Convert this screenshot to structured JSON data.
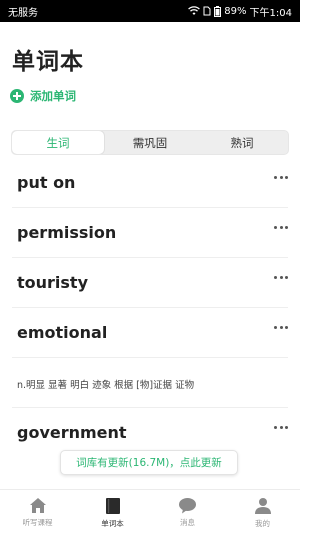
{
  "status_bar": {
    "carrier": "无服务",
    "battery": "89%",
    "time": "下午1:04"
  },
  "page": {
    "title": "单词本",
    "add_word_label": "添加单词"
  },
  "tabs": [
    {
      "label": "生词",
      "active": true
    },
    {
      "label": "需巩固",
      "active": false
    },
    {
      "label": "熟词",
      "active": false
    }
  ],
  "words": [
    {
      "text": "put on"
    },
    {
      "text": "permission"
    },
    {
      "text": "touristy"
    },
    {
      "text": "emotional"
    }
  ],
  "meaning": "n.明显 显著 明白 迹象 根据 [物]证据 证物",
  "last_word": "government",
  "update_toast": "词库有更新(16.7M)，点此更新",
  "bottom_nav": [
    {
      "label": "听写课程",
      "icon": "home-icon",
      "active": false
    },
    {
      "label": "单词本",
      "icon": "book-icon",
      "active": true
    },
    {
      "label": "消息",
      "icon": "chat-bubble-icon",
      "active": false
    },
    {
      "label": "我的",
      "icon": "person-icon",
      "active": false
    }
  ],
  "colors": {
    "accent": "#2bb673",
    "status_bar": "#000000"
  }
}
